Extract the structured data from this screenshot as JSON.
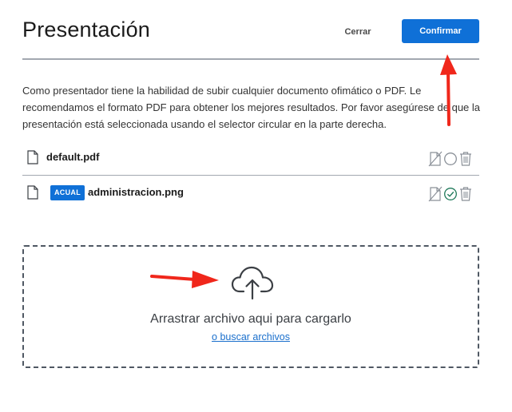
{
  "header": {
    "title": "Presentación",
    "close_label": "Cerrar",
    "confirm_label": "Confirmar"
  },
  "description": "Como presentador tiene la habilidad de subir cualquier documento ofimático o PDF. Le recomendamos el formato PDF para obtener los mejores resultados. Por favor asegúrese de que la presentación está seleccionada usando el selector circular en la parte derecha.",
  "files": [
    {
      "name": "default.pdf",
      "badge": "",
      "selected": false,
      "icons": [
        "file-icon",
        "download-disabled-icon",
        "radio-empty-icon",
        "trash-icon"
      ]
    },
    {
      "name": "administracion.png",
      "badge": "ACUAL",
      "selected": true,
      "icons": [
        "file-icon",
        "download-disabled-icon",
        "radio-checked-icon",
        "trash-icon"
      ]
    }
  ],
  "dropzone": {
    "icon": "cloud-upload-icon",
    "text": "Arrastrar archivo aqui para cargarlo",
    "link": "o buscar archivos"
  },
  "colors": {
    "accent": "#0f70d7",
    "annotation_arrow": "#f0271b",
    "selected_check": "#1f7a5a",
    "rule": "#a2a8b0"
  }
}
